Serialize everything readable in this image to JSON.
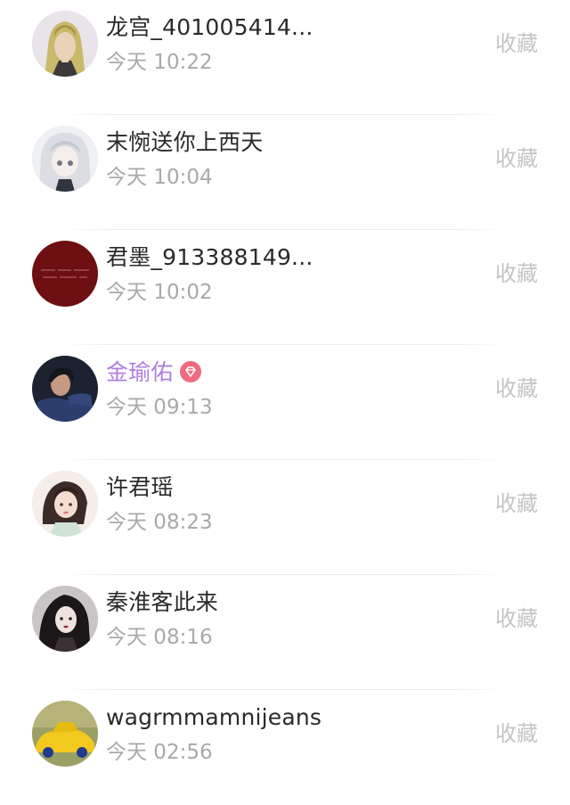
{
  "items": [
    {
      "name": "龙宫_401005414...",
      "time": "今天 10:22",
      "action": "收藏",
      "avatar": "blonde-anime-character-avatar",
      "vip": false
    },
    {
      "name": "末惋送你上西天",
      "time": "今天 10:04",
      "action": "收藏",
      "avatar": "white-hair-anime-girl-avatar",
      "vip": false
    },
    {
      "name": "君墨_913388149...",
      "time": "今天 10:02",
      "action": "收藏",
      "avatar": "dark-red-text-avatar",
      "vip": false
    },
    {
      "name": "金瑜佑",
      "time": "今天 09:13",
      "action": "收藏",
      "avatar": "man-portrait-avatar",
      "vip": true,
      "vip_icon": "diamond-vip-icon"
    },
    {
      "name": "许君瑶",
      "time": "今天 08:23",
      "action": "收藏",
      "avatar": "illustrated-woman-avatar",
      "vip": false
    },
    {
      "name": "秦淮客此来",
      "time": "今天 08:16",
      "action": "收藏",
      "avatar": "dark-haired-woman-avatar",
      "vip": false
    },
    {
      "name": "wagrmmamnijeans",
      "time": "今天 02:56",
      "action": "收藏",
      "avatar": "yellow-toy-car-avatar",
      "vip": false
    }
  ],
  "colors": {
    "name": "#2a2a2a",
    "vip_name": "#b07fe0",
    "time": "#a9a9a9",
    "action": "#c4c4c4",
    "vip_badge": "#f06b7e"
  }
}
